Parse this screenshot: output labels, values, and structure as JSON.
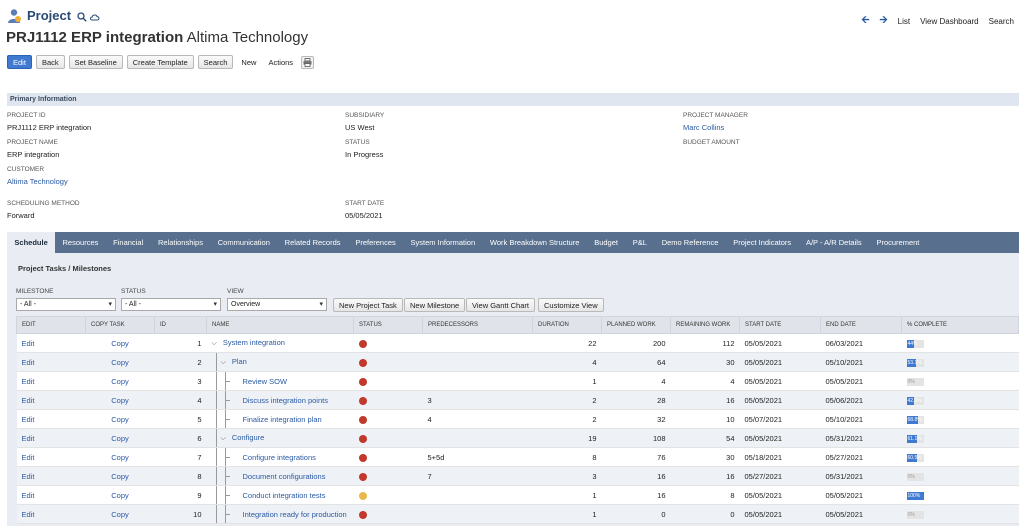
{
  "header": {
    "kind": "Project",
    "nav": {
      "list": "List",
      "view_dashboard": "View Dashboard",
      "search": "Search"
    },
    "record_id": "PRJ1112 ERP integration",
    "record_customer": "Altima Technology"
  },
  "toolbar": {
    "edit": "Edit",
    "back": "Back",
    "set_baseline": "Set Baseline",
    "create_template": "Create Template",
    "search": "Search",
    "new": "New",
    "actions": "Actions"
  },
  "primary": {
    "section_title": "Primary Information",
    "project_id_label": "Project ID",
    "project_id": "PRJ1112 ERP integration",
    "project_name_label": "Project Name",
    "project_name": "ERP integration",
    "customer_label": "Customer",
    "customer": "Altima Technology",
    "scheduling_label": "Scheduling Method",
    "scheduling": "Forward",
    "subsidiary_label": "Subsidiary",
    "subsidiary": "US West",
    "status_label": "Status",
    "status": "In Progress",
    "start_label": "Start Date",
    "start": "05/05/2021",
    "manager_label": "Project Manager",
    "manager": "Marc Collins",
    "budget_label": "Budget Amount"
  },
  "tabs": [
    "Schedule",
    "Resources",
    "Financial",
    "Relationships",
    "Communication",
    "Related Records",
    "Preferences",
    "System Information",
    "Work Breakdown Structure",
    "Budget",
    "P&L",
    "Demo Reference",
    "Project Indicators",
    "A/P - A/R Details",
    "Procurement"
  ],
  "schedule": {
    "title": "Project Tasks / Milestones",
    "milestone_label": "Milestone",
    "milestone_value": "- All -",
    "status_label": "Status",
    "status_value": "- All -",
    "view_label": "View",
    "view_value": "Overview",
    "btn_new_task": "New Project Task",
    "btn_new_milestone": "New Milestone",
    "btn_gantt": "View Gantt Chart",
    "btn_customize": "Customize View",
    "columns": [
      "Edit",
      "Copy Task",
      "ID",
      "Name",
      "Status",
      "Predecessors",
      "Duration",
      "Planned Work",
      "Remaining Work",
      "Start Date",
      "End Date",
      "% Complete"
    ],
    "status_colors": {
      "red": "#c0392b",
      "yellow": "#e8b84a"
    },
    "rows": [
      {
        "edit": "Edit",
        "copy": "Copy",
        "id": "1",
        "name": "System integration",
        "status": "red",
        "pred": "",
        "duration": "22",
        "planned": "200",
        "remaining": "112",
        "start": "05/05/2021",
        "end": "06/03/2021",
        "pct": 44,
        "pct_label": "44%",
        "level": 0,
        "expand": true
      },
      {
        "edit": "Edit",
        "copy": "Copy",
        "id": "2",
        "name": "Plan",
        "status": "red",
        "pred": "",
        "duration": "4",
        "planned": "64",
        "remaining": "30",
        "start": "05/05/2021",
        "end": "05/10/2021",
        "pct": 53.1,
        "pct_label": "53.1%",
        "level": 1,
        "expand": true
      },
      {
        "edit": "Edit",
        "copy": "Copy",
        "id": "3",
        "name": "Review SOW",
        "status": "red",
        "pred": "",
        "duration": "1",
        "planned": "4",
        "remaining": "4",
        "start": "05/05/2021",
        "end": "05/05/2021",
        "pct": 0,
        "pct_label": "0%",
        "level": 2,
        "expand": false
      },
      {
        "edit": "Edit",
        "copy": "Copy",
        "id": "4",
        "name": "Discuss integration points",
        "status": "red",
        "pred": "3",
        "duration": "2",
        "planned": "28",
        "remaining": "16",
        "start": "05/05/2021",
        "end": "05/06/2021",
        "pct": 42.9,
        "pct_label": "42.9%",
        "level": 2,
        "expand": false
      },
      {
        "edit": "Edit",
        "copy": "Copy",
        "id": "5",
        "name": "Finalize integration plan",
        "status": "red",
        "pred": "4",
        "duration": "2",
        "planned": "32",
        "remaining": "10",
        "start": "05/07/2021",
        "end": "05/10/2021",
        "pct": 68.8,
        "pct_label": "68.8%",
        "level": 2,
        "expand": false
      },
      {
        "edit": "Edit",
        "copy": "Copy",
        "id": "6",
        "name": "Configure",
        "status": "red",
        "pred": "",
        "duration": "19",
        "planned": "108",
        "remaining": "54",
        "start": "05/05/2021",
        "end": "05/31/2021",
        "pct": 61.1,
        "pct_label": "61.1%",
        "level": 1,
        "expand": true
      },
      {
        "edit": "Edit",
        "copy": "Copy",
        "id": "7",
        "name": "Configure integrations",
        "status": "red",
        "pred": "5+5d",
        "duration": "8",
        "planned": "76",
        "remaining": "30",
        "start": "05/18/2021",
        "end": "05/27/2021",
        "pct": 60.5,
        "pct_label": "60.5%",
        "level": 2,
        "expand": false
      },
      {
        "edit": "Edit",
        "copy": "Copy",
        "id": "8",
        "name": "Document configurations",
        "status": "red",
        "pred": "7",
        "duration": "3",
        "planned": "16",
        "remaining": "16",
        "start": "05/27/2021",
        "end": "05/31/2021",
        "pct": 0,
        "pct_label": "0%",
        "level": 2,
        "expand": false
      },
      {
        "edit": "Edit",
        "copy": "Copy",
        "id": "9",
        "name": "Conduct integration tests",
        "status": "yellow",
        "pred": "",
        "duration": "1",
        "planned": "16",
        "remaining": "8",
        "start": "05/05/2021",
        "end": "05/05/2021",
        "pct": 100,
        "pct_label": "100%",
        "level": 2,
        "expand": false
      },
      {
        "edit": "Edit",
        "copy": "Copy",
        "id": "10",
        "name": "Integration ready for production",
        "status": "red",
        "pred": "",
        "duration": "1",
        "planned": "0",
        "remaining": "0",
        "start": "05/05/2021",
        "end": "05/05/2021",
        "pct": 0,
        "pct_label": "0%",
        "level": 2,
        "expand": false,
        "milestone": true
      }
    ]
  }
}
